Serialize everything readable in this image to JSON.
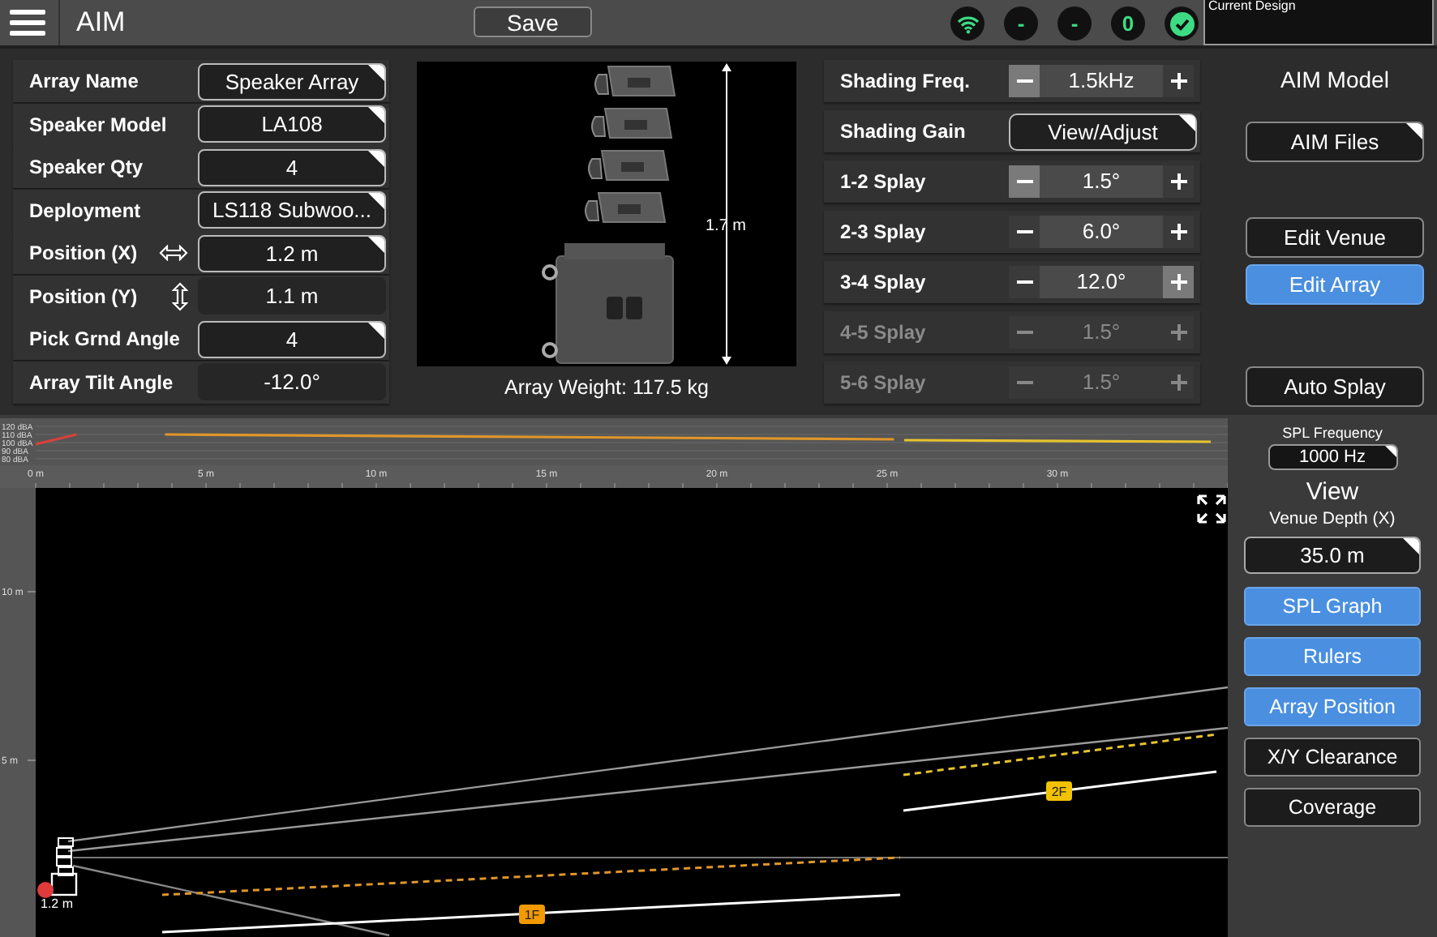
{
  "top_bar": {
    "title": "AIM",
    "save_button": "Save",
    "status": [
      {
        "kind": "wifi"
      },
      {
        "kind": "text",
        "label": "-"
      },
      {
        "kind": "text",
        "label": "-"
      },
      {
        "kind": "text",
        "label": "0"
      },
      {
        "kind": "check"
      }
    ],
    "design_panel": {
      "label": "Current Design"
    }
  },
  "array_settings": [
    {
      "kind": "plain",
      "label": "Array Name",
      "value": "Speaker Array",
      "editable": true
    },
    {
      "kind": "plain",
      "label": "Speaker Model",
      "value": "LA108",
      "editable": true
    },
    {
      "kind": "plain",
      "label": "Speaker Qty",
      "value": "4",
      "editable": true
    },
    {
      "kind": "plain",
      "label": "Deployment",
      "value": "LS118 Subwoo...",
      "editable": true
    },
    {
      "kind": "horizontal",
      "label": "Position (X)",
      "value": "1.2 m",
      "editable": true
    },
    {
      "kind": "vertical",
      "label": "Position (Y)",
      "value": "1.1 m",
      "editable": false
    },
    {
      "kind": "plain",
      "label": "Pick Grnd Angle",
      "value": "4",
      "editable": true
    },
    {
      "kind": "plain",
      "label": "Array Tilt Angle",
      "value": "-12.0°",
      "editable": false
    }
  ],
  "preview": {
    "height_label": "1.7 m",
    "weight": "Array Weight: 117.5 kg"
  },
  "controls": [
    {
      "kind": "stepper",
      "label": "Shading Freq.",
      "value": "1.5kHz",
      "minus_highlighted": true,
      "plus_highlighted": false,
      "disabled": false
    },
    {
      "kind": "button",
      "label": "Shading Gain",
      "value": "View/Adjust",
      "disabled": false
    },
    {
      "kind": "stepper",
      "label": "1-2 Splay",
      "value": "1.5°",
      "minus_highlighted": true,
      "plus_highlighted": false,
      "disabled": false
    },
    {
      "kind": "stepper",
      "label": "2-3 Splay",
      "value": "6.0°",
      "minus_highlighted": false,
      "plus_highlighted": false,
      "disabled": false
    },
    {
      "kind": "stepper",
      "label": "3-4 Splay",
      "value": "12.0°",
      "minus_highlighted": false,
      "plus_highlighted": true,
      "disabled": false
    },
    {
      "kind": "stepper",
      "label": "4-5 Splay",
      "value": "1.5°",
      "minus_highlighted": false,
      "plus_highlighted": false,
      "disabled": true
    },
    {
      "kind": "stepper",
      "label": "5-6 Splay",
      "value": "1.5°",
      "minus_highlighted": false,
      "plus_highlighted": false,
      "disabled": true
    }
  ],
  "model_panel": {
    "title": "AIM Model",
    "buttons": [
      {
        "label": "AIM Files",
        "kind": "menu",
        "selected": false
      },
      {
        "label": "Edit Venue",
        "kind": "plain",
        "selected": false
      },
      {
        "label": "Edit Array",
        "kind": "plain",
        "selected": true
      },
      {
        "label": "Auto Splay",
        "kind": "plain",
        "selected": false
      }
    ]
  },
  "spl_graph": {
    "chart_data": {
      "type": "line",
      "grid": true,
      "xlim": [
        0,
        35
      ],
      "ylim": [
        80,
        120
      ],
      "xticks": [
        {
          "value": 0,
          "label": "0 m"
        },
        {
          "value": 5,
          "label": "5 m"
        },
        {
          "value": 10,
          "label": "10 m"
        },
        {
          "value": 15,
          "label": "15 m"
        },
        {
          "value": 20,
          "label": "20 m"
        },
        {
          "value": 25,
          "label": "25 m"
        },
        {
          "value": 30,
          "label": "30 m"
        }
      ],
      "yticks": [
        {
          "value": 120,
          "label": "120 dBA"
        },
        {
          "value": 110,
          "label": "110 dBA"
        },
        {
          "value": 100,
          "label": "100 dBA"
        },
        {
          "value": 90,
          "label": "90 dBA"
        },
        {
          "value": 80,
          "label": "80 dBA"
        }
      ],
      "series": [
        {
          "color": "#d9403a",
          "x": [
            0,
            1.2
          ],
          "values": [
            98,
            110
          ]
        },
        {
          "color": "#e0962a",
          "x": [
            3.8,
            25.2
          ],
          "values": [
            110,
            104
          ]
        },
        {
          "color": "#e6c22e",
          "x": [
            25.5,
            34.5
          ],
          "values": [
            103,
            101
          ]
        }
      ]
    }
  },
  "spl_frequency": {
    "label": "SPL Frequency",
    "value": "1000 Hz"
  },
  "venue": {
    "y_labels": [
      "10 m",
      "5 m"
    ],
    "floor_labels": [
      "1F",
      "2F"
    ],
    "array_position_label": "1.2 m"
  },
  "view_panel": {
    "title": "View",
    "depth_label": "Venue Depth (X)",
    "depth_value": "35.0 m",
    "toggles": [
      {
        "label": "SPL Graph",
        "on": true
      },
      {
        "label": "Rulers",
        "on": true
      },
      {
        "label": "Array Position",
        "on": true
      },
      {
        "label": "X/Y Clearance",
        "on": false
      },
      {
        "label": "Coverage",
        "on": false
      }
    ]
  }
}
